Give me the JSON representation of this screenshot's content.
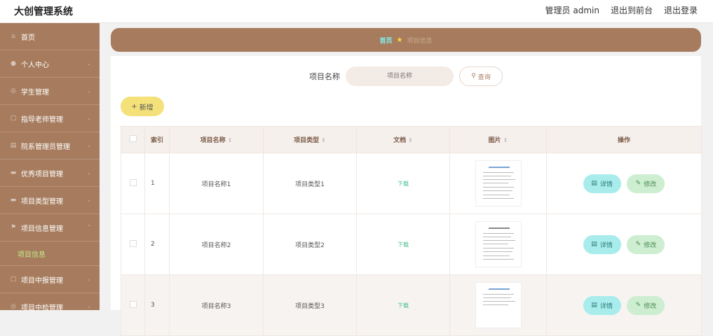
{
  "app": {
    "title": "大创管理系统"
  },
  "top": {
    "user": "管理员 admin",
    "front": "退出到前台",
    "logout": "退出登录"
  },
  "sidebar": {
    "items": [
      {
        "label": "首页",
        "icon": "home-icon"
      },
      {
        "label": "个人中心",
        "icon": "user-icon"
      },
      {
        "label": "学生管理",
        "icon": "student-icon"
      },
      {
        "label": "指导老师管理",
        "icon": "teacher-icon"
      },
      {
        "label": "院系管理员管理",
        "icon": "admin-icon"
      },
      {
        "label": "优秀项目管理",
        "icon": "star-icon"
      },
      {
        "label": "项目类型管理",
        "icon": "category-icon"
      },
      {
        "label": "项目信息管理",
        "icon": "flag-icon"
      },
      {
        "label": "项目中报管理",
        "icon": "report-icon"
      },
      {
        "label": "项目中检管理",
        "icon": "check-icon"
      }
    ],
    "sub_active": "项目信息"
  },
  "breadcrumb": {
    "home": "首页",
    "current": "项目信息"
  },
  "search": {
    "label": "项目名称",
    "placeholder": "项目名称",
    "button": "查询"
  },
  "toolbar": {
    "add": "新增"
  },
  "table": {
    "headers": {
      "index": "索引",
      "name": "项目名称",
      "type": "项目类型",
      "doc": "文档",
      "image": "图片",
      "ops": "操作"
    },
    "rows": [
      {
        "index": "1",
        "name": "项目名称1",
        "type": "项目类型1",
        "doc": "下载"
      },
      {
        "index": "2",
        "name": "项目名称2",
        "type": "项目类型2",
        "doc": "下载"
      },
      {
        "index": "3",
        "name": "项目名称3",
        "type": "项目类型3",
        "doc": "下载"
      }
    ],
    "detail": "详情",
    "edit": "修改"
  },
  "colors": {
    "sidebar": "#a77c5e",
    "accent_home": "#7ff1f1",
    "add_button": "#f4e17a"
  }
}
